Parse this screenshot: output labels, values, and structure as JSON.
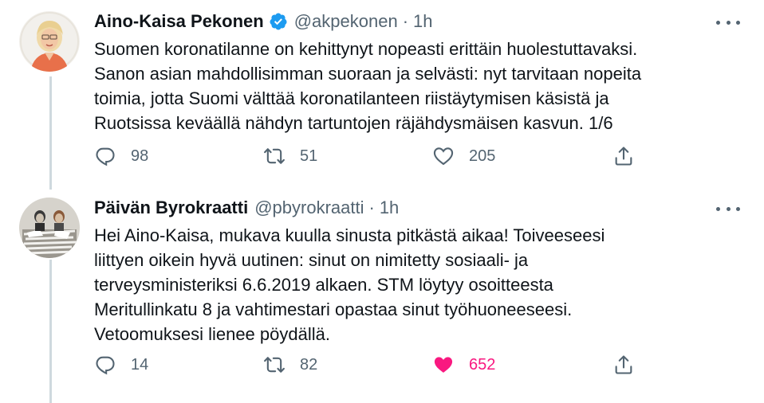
{
  "tweets": [
    {
      "name": "Aino-Kaisa Pekonen",
      "handle": "@akpekonen",
      "time": "1h",
      "verified": true,
      "text": "Suomen koronatilanne on kehittynyt nopeasti erittäin huolestuttavaksi.\nSanon asian mahdollisimman suoraan ja selvästi: nyt tarvitaan nopeita\ntoimia, jotta Suomi välttää koronatilanteen riistäytymisen käsistä ja\nRuotsissa keväällä nähdyn tartuntojen räjähdysmäisen kasvun. 1/6",
      "replies": "98",
      "retweets": "51",
      "likes": "205",
      "liked": false
    },
    {
      "name": "Päivän Byrokraatti",
      "handle": "@pbyrokraatti",
      "time": "1h",
      "verified": false,
      "text": "Hei Aino-Kaisa, mukava kuulla sinusta pitkästä aikaa! Toiveeseesi\nliittyen oikein hyvä uutinen: sinut on nimitetty sosiaali- ja\nterveysministeriksi 6.6.2019 alkaen. STM löytyy osoitteesta\nMeritullinkatu 8 ja vahtimestari opastaa sinut työhuoneeseesi.\nVetoomuksesi lienee pöydällä.",
      "replies": "14",
      "retweets": "82",
      "likes": "652",
      "liked": true
    }
  ],
  "colors": {
    "verified": "#1d9bf0",
    "like_active": "#f91880",
    "secondary_text": "#536471"
  },
  "icons": [
    "more-icon",
    "verified-badge-icon",
    "reply-icon",
    "retweet-icon",
    "like-icon",
    "share-icon"
  ]
}
